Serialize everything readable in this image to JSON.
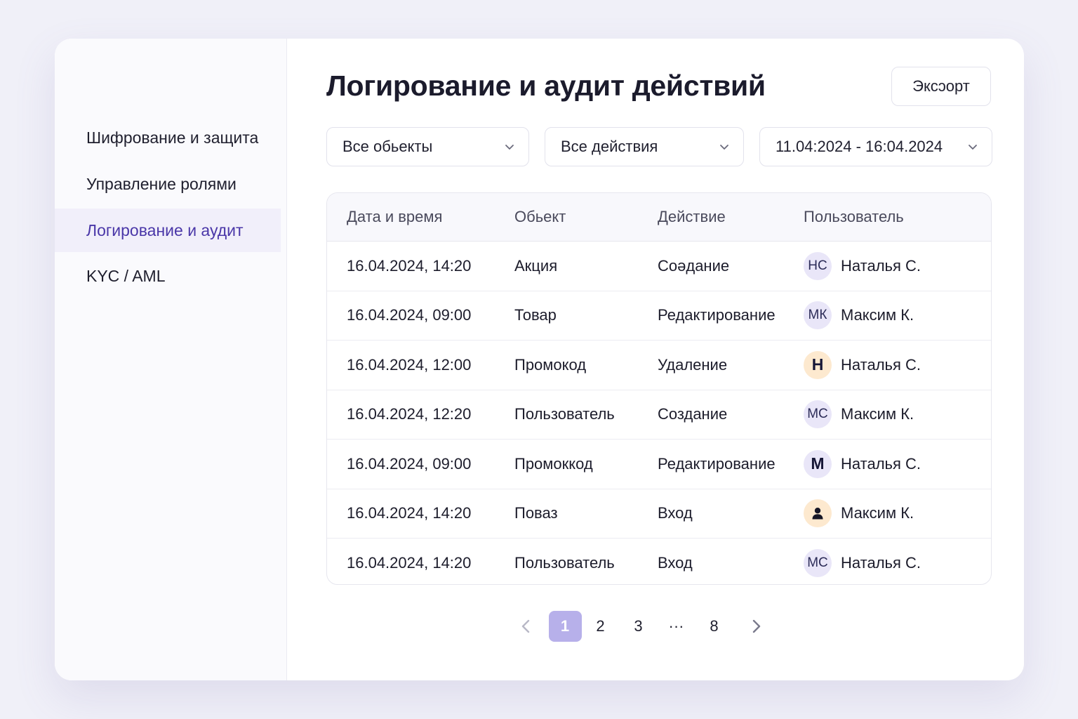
{
  "sidebar": {
    "items": [
      {
        "label": "Шифрование и защита",
        "active": false
      },
      {
        "label": "Управление ролями",
        "active": false
      },
      {
        "label": "Логирование и аудит",
        "active": true
      },
      {
        "label": "KYC / AML",
        "active": false
      }
    ]
  },
  "header": {
    "title": "Логирование и аудит действий",
    "export_label": "Эксɔорт"
  },
  "filters": {
    "objects": "Все обьекты",
    "actions": "Все действия",
    "dates": "11.04:2024 - 16:04.2024"
  },
  "table": {
    "columns": [
      "Дата и время",
      "Обьект",
      "Действие",
      "Пользователь"
    ],
    "rows": [
      {
        "datetime": "16.04.2024, 14:20",
        "object": "Акция",
        "action": "Соəдание",
        "avatar_text": "НС",
        "avatar_icon": "",
        "user": "Наталья С."
      },
      {
        "datetime": "16.04.2024, 09:00",
        "object": "Товар",
        "action": "Редактирование",
        "avatar_text": "МК",
        "avatar_icon": "",
        "user": "Максим К."
      },
      {
        "datetime": "16.04.2024, 12:00",
        "object": "Промокод",
        "action": "Удаление",
        "avatar_text": "Н",
        "avatar_icon": "",
        "user": "Наталья С."
      },
      {
        "datetime": "16.04.2024, 12:20",
        "object": "Пользователь",
        "action": "Создание",
        "avatar_text": "МС",
        "avatar_icon": "",
        "user": "Максим К."
      },
      {
        "datetime": "16.04.2024, 09:00",
        "object": "Промоккод",
        "action": "Редактирование",
        "avatar_text": "М",
        "avatar_icon": "",
        "user": "Наталья С."
      },
      {
        "datetime": "16.04.2024, 14:20",
        "object": "Поваз",
        "action": "Вход",
        "avatar_text": "",
        "avatar_icon": "user-icon",
        "user": "Максим К."
      },
      {
        "datetime": "16.04.2024, 14:20",
        "object": "Пользователь",
        "action": "Вход",
        "avatar_text": "МС",
        "avatar_icon": "",
        "user": "Наталья С."
      }
    ]
  },
  "pagination": {
    "pages": [
      "1",
      "2",
      "3",
      "···",
      "8"
    ],
    "current": "1"
  },
  "colors": {
    "accent": "#4a37a8",
    "current_page": "#b7b0ea",
    "avatar_lavender": "#e9e6f8",
    "avatar_peach": "#fde9cf"
  }
}
